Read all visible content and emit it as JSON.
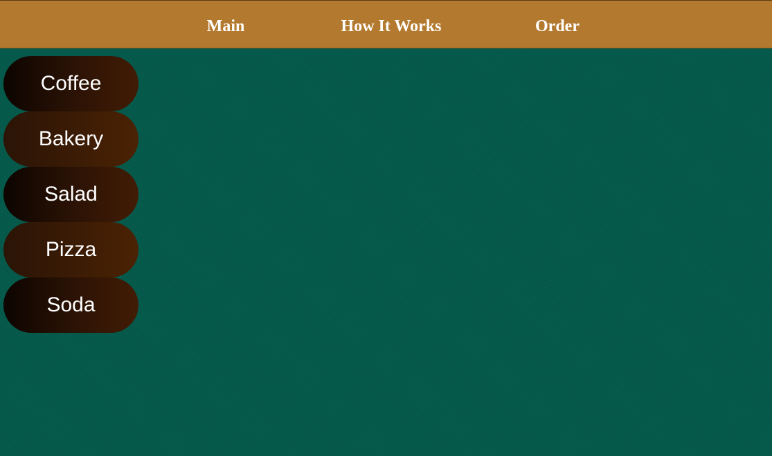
{
  "header": {
    "nav": [
      {
        "label": "Main"
      },
      {
        "label": "How It Works"
      },
      {
        "label": "Order"
      }
    ]
  },
  "sidebar": {
    "items": [
      {
        "label": "Coffee"
      },
      {
        "label": "Bakery"
      },
      {
        "label": "Salad"
      },
      {
        "label": "Pizza"
      },
      {
        "label": "Soda"
      }
    ]
  },
  "colors": {
    "header_bg": "#b37a2f",
    "page_bg": "#045a4b",
    "menu_item_dark": "#2a1205",
    "menu_item_light": "#3a1b05",
    "text": "#ffffff"
  }
}
